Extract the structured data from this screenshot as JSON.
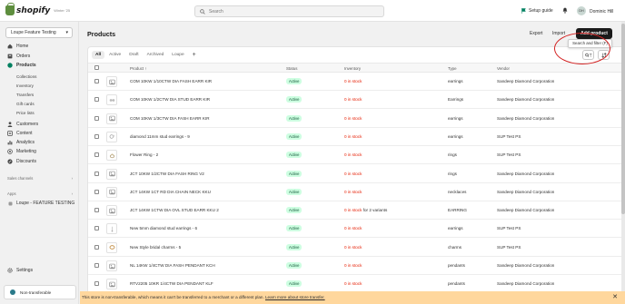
{
  "topbar": {
    "logo_text": "shopify",
    "logo_version": "Winter '25",
    "search_placeholder": "Search",
    "setup_guide": "Setup guide",
    "avatar_initials": "DH",
    "user_name": "Dominic Hill"
  },
  "sidebar": {
    "store_name": "Loupe Feature Testing",
    "items": [
      {
        "label": "Home",
        "icon": "home-icon"
      },
      {
        "label": "Orders",
        "icon": "orders-icon"
      },
      {
        "label": "Products",
        "icon": "tag-icon"
      },
      {
        "label": "Customers",
        "icon": "person-icon"
      },
      {
        "label": "Content",
        "icon": "content-icon"
      },
      {
        "label": "Analytics",
        "icon": "chart-icon"
      },
      {
        "label": "Marketing",
        "icon": "target-icon"
      },
      {
        "label": "Discounts",
        "icon": "discount-icon"
      }
    ],
    "product_subitems": [
      "Collections",
      "Inventory",
      "Transfers",
      "Gift cards",
      "Price lists"
    ],
    "sales_channels": "Sales channels",
    "apps": "Apps",
    "app_item": "Loupe - FEATURE TESTING",
    "settings": "Settings",
    "non_transferable": "Non-transferable"
  },
  "main": {
    "title": "Products",
    "export": "Export",
    "import": "Import",
    "add_product": "Add product",
    "tooltip": "Search and filter (F)",
    "tabs": [
      "All",
      "Active",
      "Draft",
      "Archived",
      "Loupe"
    ],
    "add_tab": "+",
    "columns": {
      "product": "Product ↑",
      "status": "Status",
      "inventory": "Inventory",
      "type": "Type",
      "vendor": "Vendor"
    },
    "rows": [
      {
        "product": "COM 10KW 1/10CTW DIA FASH EARR KIR",
        "status": "Active",
        "inv": "0 in stock",
        "inv_extra": "",
        "type": "earrings",
        "vendor": "Sandeep Diamond Corporation",
        "thumb": "image-placeholder-icon"
      },
      {
        "product": "COM 10KW 1/2CTW DIA STUD EARR KIR",
        "status": "Active",
        "inv": "0 in stock",
        "inv_extra": "",
        "type": "Earrings",
        "vendor": "Sandeep Diamond Corporation",
        "thumb": "stud-earrings-icon"
      },
      {
        "product": "COM 10KW 1/3CTW DIA FASH EARR KIR",
        "status": "Active",
        "inv": "0 in stock",
        "inv_extra": "",
        "type": "earrings",
        "vendor": "Sandeep Diamond Corporation",
        "thumb": "image-placeholder-icon"
      },
      {
        "product": "diamond 11mm stud earrings - 9",
        "status": "Active",
        "inv": "0 in stock",
        "inv_extra": "",
        "type": "earrings",
        "vendor": "SUP Test PS",
        "thumb": "earring-photo-icon"
      },
      {
        "product": "Flower Ring - 2",
        "status": "Active",
        "inv": "0 in stock",
        "inv_extra": "",
        "type": "rings",
        "vendor": "SUP Test PS",
        "thumb": "ring-photo-icon"
      },
      {
        "product": "JCT 10KW 1/2CTW DIA FASH RING V2",
        "status": "Active",
        "inv": "0 in stock",
        "inv_extra": "",
        "type": "rings",
        "vendor": "Sandeep Diamond Corporation",
        "thumb": "image-placeholder-icon"
      },
      {
        "product": "JCT 14KW 1CT RD DIA CHAIN NECK KKU",
        "status": "Active",
        "inv": "0 in stock",
        "inv_extra": "",
        "type": "necklaces",
        "vendor": "Sandeep Diamond Corporation",
        "thumb": "image-placeholder-icon"
      },
      {
        "product": "JCT 14KW 1CTW DIA OVL STUD EARR KKU 2",
        "status": "Active",
        "inv": "0 in stock",
        "inv_extra": " for 2 variants",
        "type": "EARRING",
        "vendor": "Sandeep Diamond Corporation",
        "thumb": "image-placeholder-icon"
      },
      {
        "product": "New 5mm diamond stud earrings - 6",
        "status": "Active",
        "inv": "0 in stock",
        "inv_extra": "",
        "type": "earrings",
        "vendor": "SUP Test PS",
        "thumb": "earring-drop-icon"
      },
      {
        "product": "New Style bridal charms - 5",
        "status": "Active",
        "inv": "0 in stock",
        "inv_extra": "",
        "type": "charms",
        "vendor": "SUP Test PS",
        "thumb": "charm-photo-icon"
      },
      {
        "product": "NL 14KW 1/4CTW DIA FASH PENDANT KCH",
        "status": "Active",
        "inv": "0 in stock",
        "inv_extra": "",
        "type": "pendants",
        "vendor": "Sandeep Diamond Corporation",
        "thumb": "image-placeholder-icon"
      },
      {
        "product": "RTV2205 10KR 1/4CTW DIA PENDANT KLF",
        "status": "Active",
        "inv": "0 in stock",
        "inv_extra": "",
        "type": "pendants",
        "vendor": "Sandeep Diamond Corporation",
        "thumb": "image-placeholder-icon"
      }
    ]
  },
  "banner": {
    "text": "This store is non-transferable, which means it can't be transferred to a merchant or a different plan. ",
    "link": "Learn more about store transfer.",
    "close": "✕"
  },
  "colors": {
    "accent_green": "#008060",
    "status_bg": "#cdfee1",
    "out_of_stock": "#e51c00",
    "banner": "#ffd79d",
    "annotation_circle": "#d32222"
  }
}
